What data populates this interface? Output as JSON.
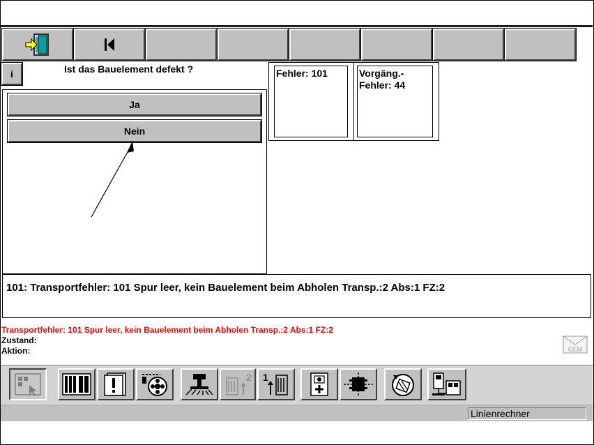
{
  "toolbar": {
    "buttons": [
      {
        "icon": "exit-door-icon"
      },
      {
        "icon": "skip-to-start-icon"
      },
      {
        "icon": ""
      },
      {
        "icon": ""
      },
      {
        "icon": ""
      },
      {
        "icon": ""
      },
      {
        "icon": ""
      },
      {
        "icon": ""
      }
    ]
  },
  "info_button": {
    "label": "i"
  },
  "dialog": {
    "question": "Ist das Bauelement defekt ?",
    "yes_label": "Ja",
    "no_label": "Nein"
  },
  "errors": {
    "current_label": "Fehler: 101",
    "previous_label_line1": "Vorgäng.-",
    "previous_label_line2": "Fehler: 44"
  },
  "message": "101: Transportfehler: 101  Spur leer, kein Bauelement beim Abholen  Transp.:2  Abs:1  FZ:2",
  "status": {
    "line": "Transportfehler: 101  Spur leer, kein Bauelement beim Abholen  Transp.:2  Abs:1  FZ:2",
    "zustand_label": "Zustand:",
    "aktion_label": "Aktion:",
    "line_color": "#ff0000"
  },
  "gem_badge": "GEM",
  "bottom_toolbar": {
    "tools": [
      "select-icon",
      "component-magazine-icon",
      "message-icon",
      "feeder-reel-icon",
      "placement-head-icon",
      "step-2-icon",
      "step-1-icon",
      "camera-add-icon",
      "centering-icon",
      "rotate-icon",
      "line-computer-icon"
    ]
  },
  "statusbar": {
    "label": "Linienrechner"
  }
}
